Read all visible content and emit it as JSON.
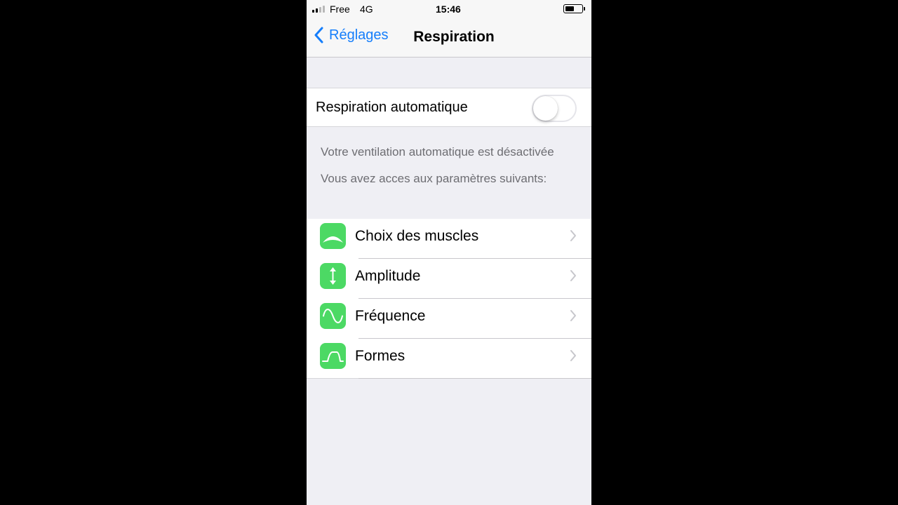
{
  "status_bar": {
    "carrier": "Free",
    "network": "4G",
    "time": "15:46",
    "battery_level": 0.55,
    "signal_bars": 2,
    "signal_icon": "cellular-signal-icon",
    "battery_icon": "battery-icon"
  },
  "nav": {
    "back_label": "Réglages",
    "back_icon": "chevron-left-icon",
    "title": "Respiration"
  },
  "toggle": {
    "label": "Respiration automatique",
    "state": false
  },
  "info": {
    "line1": "Votre ventilation automatique est désactivée",
    "line2": "Vous avez acces aux paramètres suivants:"
  },
  "menu": {
    "items": [
      {
        "label": "Choix des muscles",
        "icon": "arc-icon"
      },
      {
        "label": "Amplitude",
        "icon": "vertical-arrows-icon"
      },
      {
        "label": "Fréquence",
        "icon": "sine-wave-icon"
      },
      {
        "label": "Formes",
        "icon": "waveform-shape-icon"
      }
    ],
    "chevron_icon": "chevron-right-icon"
  },
  "colors": {
    "accent_blue": "#157efb",
    "icon_green": "#4cd964",
    "background": "#efeff4"
  }
}
